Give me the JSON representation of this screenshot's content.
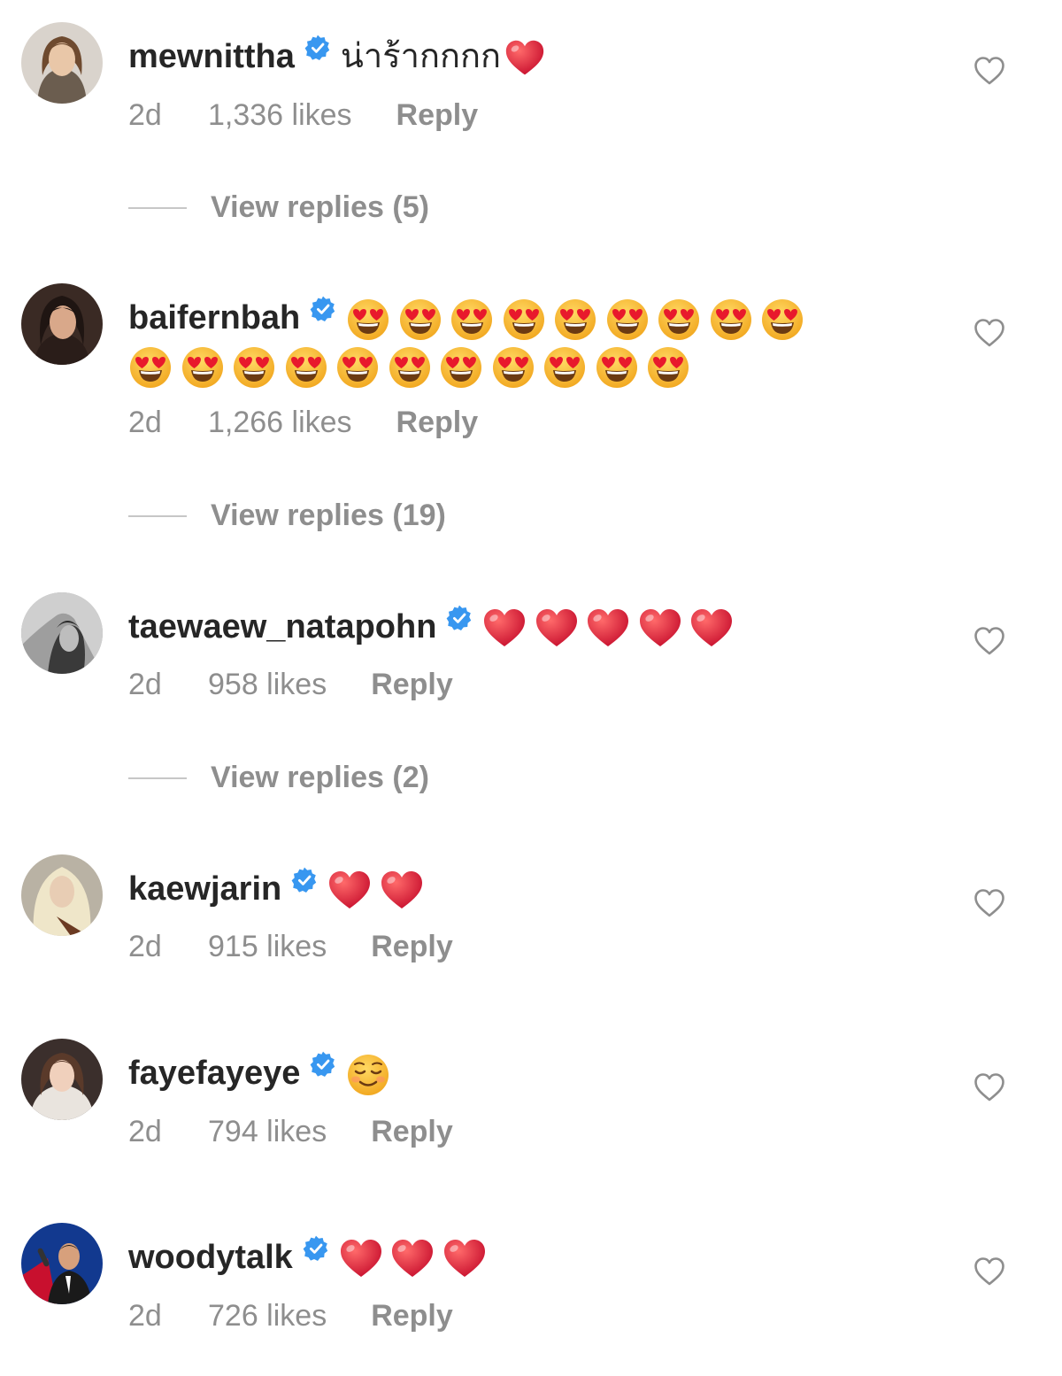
{
  "colors": {
    "text": "#262626",
    "muted": "#8e8e8e",
    "verified": "#3897f0",
    "heart_red": "#e0192d",
    "emoji_yellow": "#f7c23a"
  },
  "icons": {
    "verified": "verified-badge-icon",
    "like": "heart-outline-icon",
    "heart_emoji": "red-heart-emoji",
    "heart_eyes_emoji": "heart-eyes-emoji",
    "smile_emoji": "smiling-face-emoji"
  },
  "comments": [
    {
      "username": "mewnittha",
      "text": "น่าร้ากกกก",
      "emoji_line1": [
        "red-heart"
      ],
      "emoji_line2": [],
      "time": "2d",
      "likes": "1,336 likes",
      "reply": "Reply",
      "view_replies": "View replies (5)"
    },
    {
      "username": "baifernbah",
      "text": "",
      "emoji_line1": [
        "heart-eyes",
        "heart-eyes",
        "heart-eyes",
        "heart-eyes",
        "heart-eyes",
        "heart-eyes",
        "heart-eyes",
        "heart-eyes",
        "heart-eyes"
      ],
      "emoji_line2": [
        "heart-eyes",
        "heart-eyes",
        "heart-eyes",
        "heart-eyes",
        "heart-eyes",
        "heart-eyes",
        "heart-eyes",
        "heart-eyes",
        "heart-eyes",
        "heart-eyes",
        "heart-eyes"
      ],
      "time": "2d",
      "likes": "1,266 likes",
      "reply": "Reply",
      "view_replies": "View replies (19)"
    },
    {
      "username": "taewaew_natapohn",
      "text": "",
      "emoji_line1": [
        "red-heart",
        "red-heart",
        "red-heart",
        "red-heart",
        "red-heart"
      ],
      "emoji_line2": [],
      "time": "2d",
      "likes": "958 likes",
      "reply": "Reply",
      "view_replies": "View replies (2)"
    },
    {
      "username": "kaewjarin",
      "text": "",
      "emoji_line1": [
        "red-heart",
        "red-heart"
      ],
      "emoji_line2": [],
      "time": "2d",
      "likes": "915 likes",
      "reply": "Reply",
      "view_replies": ""
    },
    {
      "username": "fayefayeye",
      "text": "",
      "emoji_line1": [
        "smiling-face"
      ],
      "emoji_line2": [],
      "time": "2d",
      "likes": "794 likes",
      "reply": "Reply",
      "view_replies": ""
    },
    {
      "username": "woodytalk",
      "text": "",
      "emoji_line1": [
        "red-heart",
        "red-heart",
        "red-heart"
      ],
      "emoji_line2": [],
      "time": "2d",
      "likes": "726 likes",
      "reply": "Reply",
      "view_replies": ""
    }
  ]
}
